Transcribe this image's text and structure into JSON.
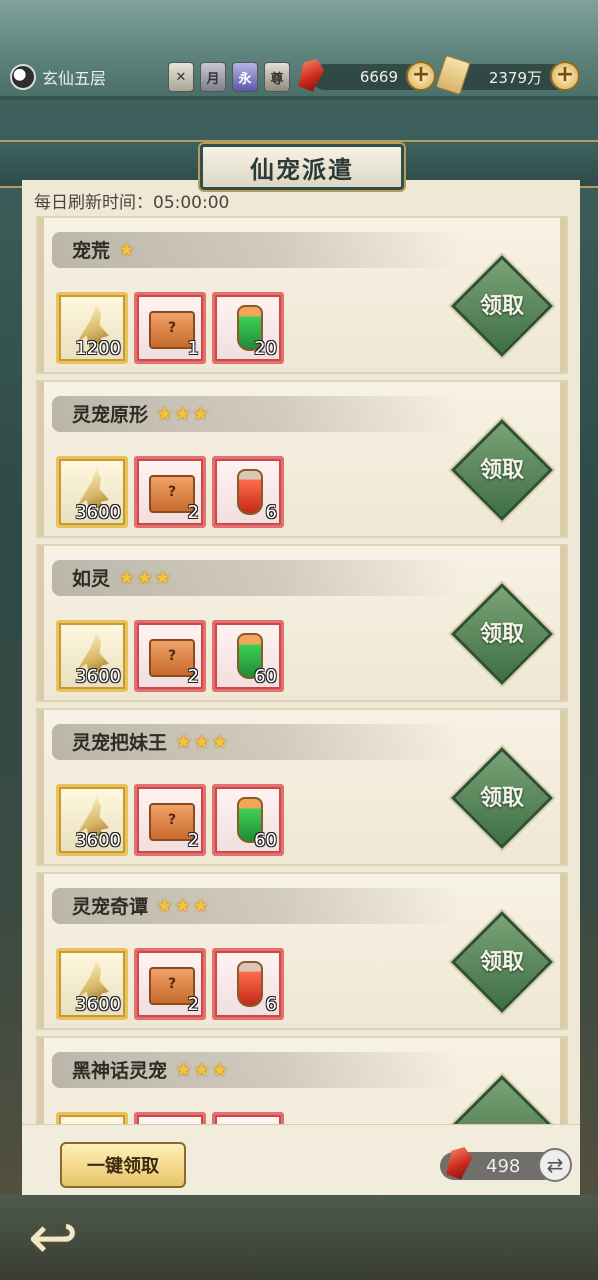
{
  "header": {
    "rank_label": "玄仙五层",
    "badges": [
      "",
      "月",
      "永",
      "尊"
    ],
    "currency_gem": "6669",
    "currency_scroll": "2379万"
  },
  "window": {
    "title": "仙宠派遣",
    "refresh_label": "每日刷新时间：05:00:00"
  },
  "missions": [
    {
      "name": "宠荒",
      "stars": 1,
      "rewards": [
        "1200",
        "1",
        "20"
      ],
      "potion": "green",
      "claim_label": "领取"
    },
    {
      "name": "灵宠原形",
      "stars": 3,
      "rewards": [
        "3600",
        "2",
        "6"
      ],
      "potion": "red",
      "claim_label": "领取"
    },
    {
      "name": "如灵",
      "stars": 3,
      "rewards": [
        "3600",
        "2",
        "60"
      ],
      "potion": "green",
      "claim_label": "领取"
    },
    {
      "name": "灵宠把妹王",
      "stars": 3,
      "rewards": [
        "3600",
        "2",
        "60"
      ],
      "potion": "green",
      "claim_label": "领取"
    },
    {
      "name": "灵宠奇谭",
      "stars": 3,
      "rewards": [
        "3600",
        "2",
        "6"
      ],
      "potion": "red",
      "claim_label": "领取"
    },
    {
      "name": "黑神话灵宠",
      "stars": 3,
      "rewards": [
        "",
        "",
        ""
      ],
      "potion": "green",
      "claim_label": ""
    }
  ],
  "footer": {
    "claim_all_label": "一键领取",
    "gem_count": "498"
  },
  "icons": {
    "rank": "yin-yang-icon",
    "back": "back-arrow-icon",
    "swap": "refresh-swap-icon"
  },
  "colors": {
    "claim_button": "#4f7f52",
    "star": "#f5c33b",
    "panel": "#efe8d6"
  }
}
